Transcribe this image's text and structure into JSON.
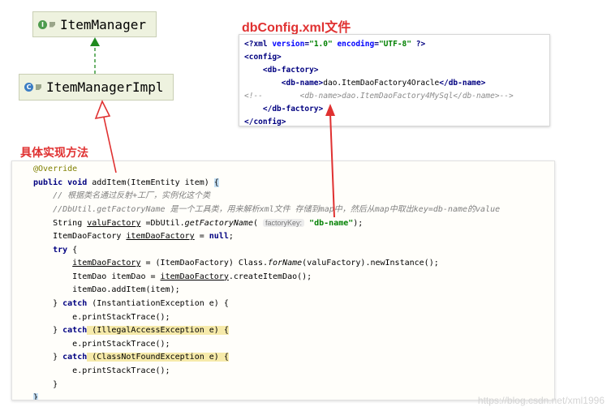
{
  "uml": {
    "interface_name": "ItemManager",
    "interface_icon": "I",
    "impl_name": "ItemManagerImpl",
    "impl_icon": "C"
  },
  "labels": {
    "xml_title": "dbConfig.xml文件",
    "method_title": "具体实现方法"
  },
  "xml": {
    "decl_open": "<?xml ",
    "decl_attr1": "version",
    "decl_val1": "\"1.0\"",
    "decl_attr2": "encoding",
    "decl_val2": "\"UTF-8\"",
    "decl_close": " ?>",
    "config_open": "<config>",
    "dbfactory_open": "<db-factory>",
    "dbname_open": "<db-name>",
    "dbname_value": "dao.ItemDaoFactory4Oracle",
    "dbname_close": "</db-name>",
    "comment": "<!--        <db-name>dao.ItemDaoFactory4MySql</db-name>-->",
    "dbfactory_close": "</db-factory>",
    "config_close": "</config>"
  },
  "code": {
    "l1": "@Override",
    "l2_kw1": "public",
    "l2_kw2": "void",
    "l2_rest": " addItem(ItemEntity item) ",
    "l2_brace": "{",
    "l3": "// 根据类名通过反射+工厂，实例化这个类",
    "l4": "//DbUtil.getFactoryName 是一个工具类，用来解析xml文件 存储到map中，然后从map中取出key=db-name的value",
    "l5_a": "String ",
    "l5_var": "valuFactory",
    "l5_b": " =DbUtil.",
    "l5_method": "getFactoryName",
    "l5_c": "( ",
    "l5_hint": "factoryKey:",
    "l5_str": "\"db-name\"",
    "l5_d": ");",
    "l6_a": "ItemDaoFactory ",
    "l6_var": "itemDaoFactory",
    "l6_b": " = ",
    "l6_null": "null",
    "l6_c": ";",
    "l7_kw": "try",
    "l7_rest": " {",
    "l8_var": "itemDaoFactory",
    "l8_a": " = (ItemDaoFactory) Class.",
    "l8_method": "forName",
    "l8_b": "(valuFactory).newInstance();",
    "l9_a": "ItemDao itemDao = ",
    "l9_var": "itemDaoFactory",
    "l9_b": ".createItemDao();",
    "l10": "itemDao.addItem(item);",
    "l11_a": "} ",
    "l11_kw": "catch",
    "l11_b": " (InstantiationException e) {",
    "l12": "e.printStackTrace();",
    "l13_a": "} ",
    "l13_kw": "catch",
    "l13_b": " (IllegalAccessException e) {",
    "l14": "e.printStackTrace();",
    "l15_a": "} ",
    "l15_kw": "catch",
    "l15_b": " (ClassNotFoundException e) {",
    "l16": "e.printStackTrace();",
    "l17": "}",
    "l18": "}"
  },
  "watermark": "https://blog.csdn.net/xml1996",
  "colors": {
    "accent_red": "#e03131",
    "uml_bg": "#eef2df",
    "arrow_green": "#1f8a1f"
  }
}
